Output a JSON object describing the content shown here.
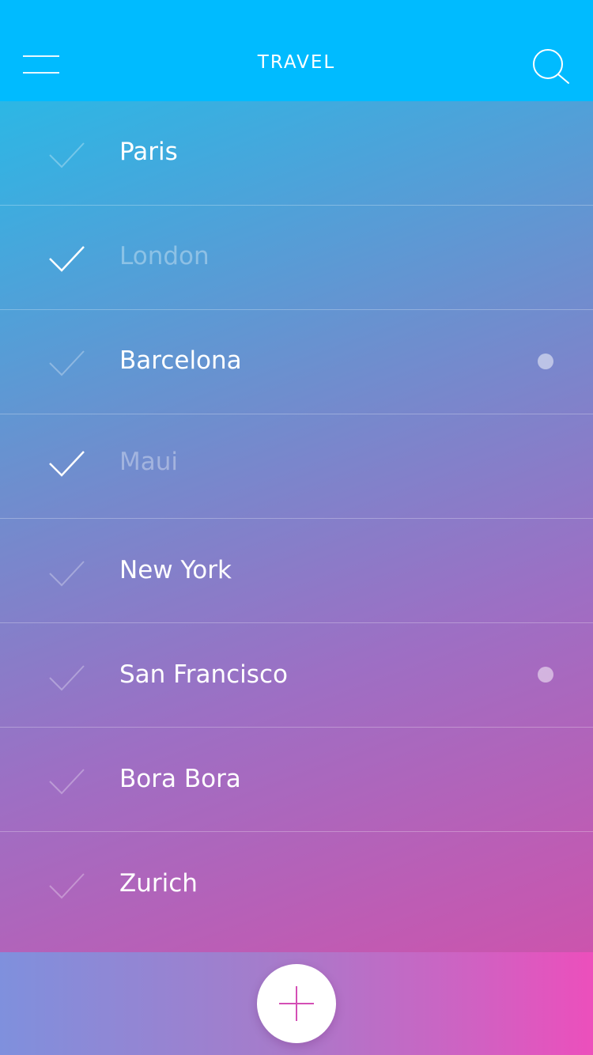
{
  "header": {
    "title": "TRAVEL",
    "menu_icon": "hamburger-menu-icon",
    "search_icon": "search-icon"
  },
  "list": {
    "items": [
      {
        "label": "Paris",
        "done": false,
        "dot": false
      },
      {
        "label": "London",
        "done": true,
        "dot": false
      },
      {
        "label": "Barcelona",
        "done": false,
        "dot": true
      },
      {
        "label": "Maui",
        "done": true,
        "dot": false
      },
      {
        "label": "New York",
        "done": false,
        "dot": false
      },
      {
        "label": "San Francisco",
        "done": false,
        "dot": true
      },
      {
        "label": "Bora Bora",
        "done": false,
        "dot": false
      },
      {
        "label": "Zurich",
        "done": false,
        "dot": false
      }
    ]
  },
  "footer": {
    "add_icon": "plus-icon"
  },
  "colors": {
    "header": "#00bbff",
    "accent": "#d44fb5",
    "text": "#ffffff"
  }
}
